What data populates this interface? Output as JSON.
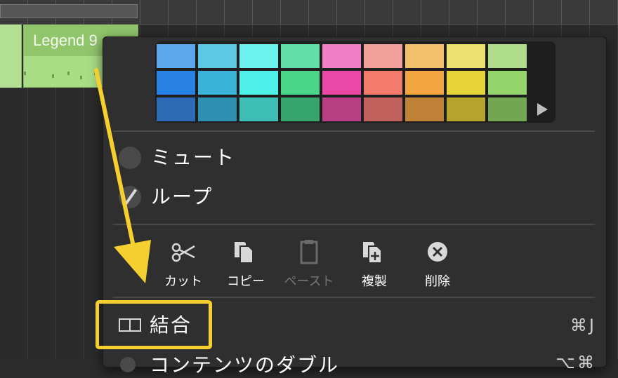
{
  "arrangement": {
    "region_name": "Legend 9"
  },
  "menu": {
    "palette": {
      "rows": [
        [
          "#5aa7ec",
          "#5dc8e2",
          "#6cf2ef",
          "#62dea9",
          "#f07fc5",
          "#f4a09a",
          "#f3c06c",
          "#ede26f",
          "#b0dd8b"
        ],
        [
          "#2782e4",
          "#3bb2da",
          "#4ff0ea",
          "#4bd588",
          "#ea48a7",
          "#f27b6c",
          "#f3a541",
          "#e6d43a",
          "#93d56a"
        ],
        [
          "#2d6cb4",
          "#2f8fb0",
          "#3ebdb5",
          "#37a46d",
          "#b93f85",
          "#c0615b",
          "#bf8238",
          "#b5a42d",
          "#72a653"
        ]
      ],
      "more_label": "▶"
    },
    "toggles": [
      {
        "label": "ミュート",
        "checked": false
      },
      {
        "label": "ループ",
        "checked": true
      }
    ],
    "tools": [
      {
        "label": "カット",
        "icon": "scissors-icon",
        "enabled": true
      },
      {
        "label": "コピー",
        "icon": "copy-icon",
        "enabled": true
      },
      {
        "label": "ペースト",
        "icon": "clipboard-icon",
        "enabled": false
      },
      {
        "label": "複製",
        "icon": "duplicate-icon",
        "enabled": true
      },
      {
        "label": "削除",
        "icon": "delete-icon",
        "enabled": true
      }
    ],
    "join": {
      "label": "結合",
      "shortcut": "⌘J",
      "icon": "join-icon"
    },
    "next_item": {
      "label": "コンテンツのダブル",
      "shortcut": "⌥⌘"
    }
  },
  "annotation": {
    "highlight_color": "#f5cf2f",
    "arrow_color": "#f5cf2f"
  }
}
